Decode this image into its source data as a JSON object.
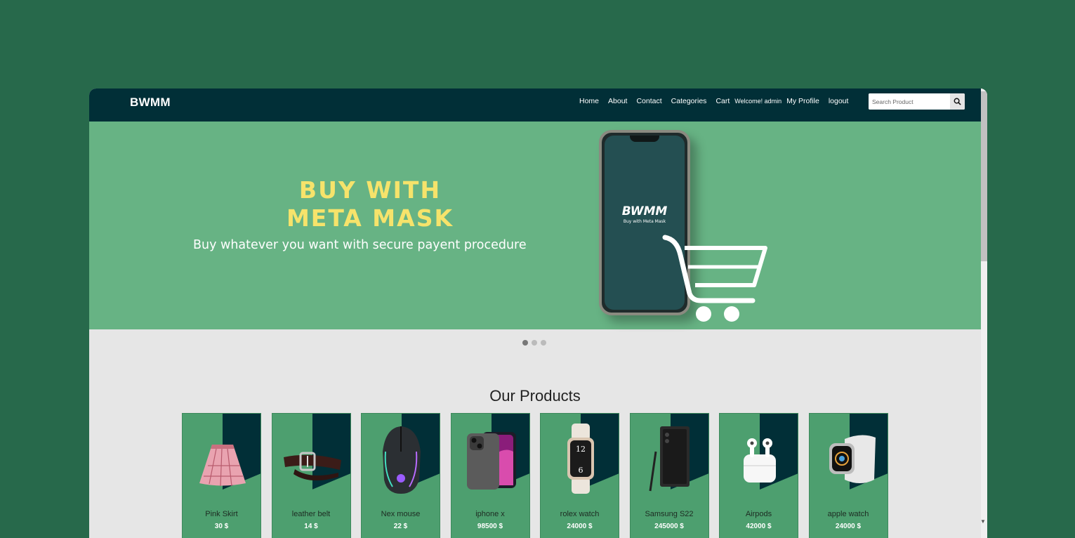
{
  "navbar": {
    "brand": "BWMM",
    "links": [
      "Home",
      "About",
      "Contact",
      "Categories",
      "Cart"
    ],
    "welcome": "Welcome! admin",
    "profile": "My Profile",
    "logout": "logout",
    "search_placeholder": "Search Product"
  },
  "banner": {
    "title_line1": "BUY WITH",
    "title_line2": "META MASK",
    "subtitle": "Buy whatever you want with secure payent procedure",
    "phone_logo": "BWMM",
    "phone_tagline": "Buy with Meta Mask",
    "carousel_slides": 3,
    "carousel_active": 1
  },
  "products": {
    "title": "Our Products",
    "items": [
      {
        "name": "Pink Skirt",
        "price": "30 $",
        "icon": "skirt-image"
      },
      {
        "name": "leather belt",
        "price": "14 $",
        "icon": "belt-image"
      },
      {
        "name": "Nex mouse",
        "price": "22 $",
        "icon": "mouse-image"
      },
      {
        "name": "iphone x",
        "price": "98500 $",
        "icon": "iphone-image"
      },
      {
        "name": "rolex watch",
        "price": "24000 $",
        "icon": "watch-image"
      },
      {
        "name": "Samsung S22",
        "price": "245000 $",
        "icon": "samsung-phone-image"
      },
      {
        "name": "Airpods",
        "price": "42000 $",
        "icon": "airpods-image"
      },
      {
        "name": "apple watch",
        "price": "24000 $",
        "icon": "apple-watch-image"
      }
    ]
  },
  "colors": {
    "page_bg": "#27694b",
    "navbar": "#012f37",
    "banner": "#67b384",
    "banner_title": "#f6e36b",
    "card": "#4d9f6f"
  }
}
